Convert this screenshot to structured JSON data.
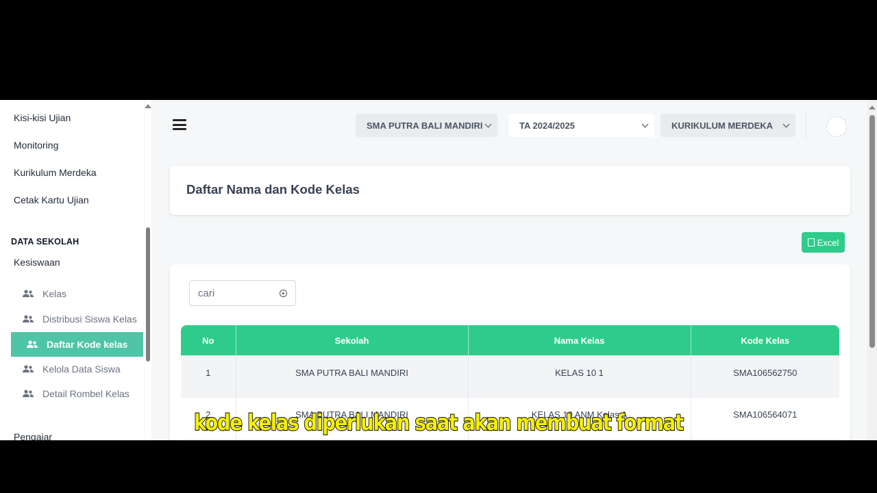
{
  "sidebar": {
    "items_top": [
      "Kisi-kisi Ujian",
      "Monitoring",
      "Kurikulum Merdeka",
      "Cetak Kartu Ujian"
    ],
    "section_heading": "DATA SEKOLAH",
    "group_label": "Kesiswaan",
    "sub_items": [
      "Kelas",
      "Distribusi Siswa Kelas",
      "Daftar Kode kelas",
      "Kelola Data Siswa",
      "Detail Rombel Kelas"
    ],
    "active_item": "Daftar Kode kelas",
    "bottom_item": "Pengajar"
  },
  "topbar": {
    "school_select": "SMA PUTRA BALI MANDIRI",
    "year_select": "TA 2024/2025",
    "curriculum_select": "KURIKULUM MERDEKA"
  },
  "page": {
    "title": "Daftar Nama dan Kode Kelas",
    "excel_label": "Excel",
    "search_placeholder": "cari"
  },
  "table": {
    "headers": [
      "No",
      "Sekolah",
      "Nama Kelas",
      "Kode Kelas"
    ],
    "rows": [
      [
        "1",
        "SMA PUTRA BALI MANDIRI",
        "KELAS 10 1",
        "SMA106562750"
      ],
      [
        "2",
        "SMA PUTRA BALI MANDIRI",
        "KELAS 10 ANM Kelas A",
        "SMA106564071"
      ]
    ]
  },
  "subtitle": "kode kelas diperlukan saat akan membuat format",
  "colors": {
    "accent_green": "#2ecc8a",
    "active_teal": "#4fc4a6",
    "subtitle_yellow": "#f5f000"
  },
  "icons": {
    "menu": "hamburger-icon",
    "dropdown": "chevron-down-icon",
    "users": "users-icon",
    "excel": "file-excel-icon",
    "search_clear": "clear-icon"
  }
}
